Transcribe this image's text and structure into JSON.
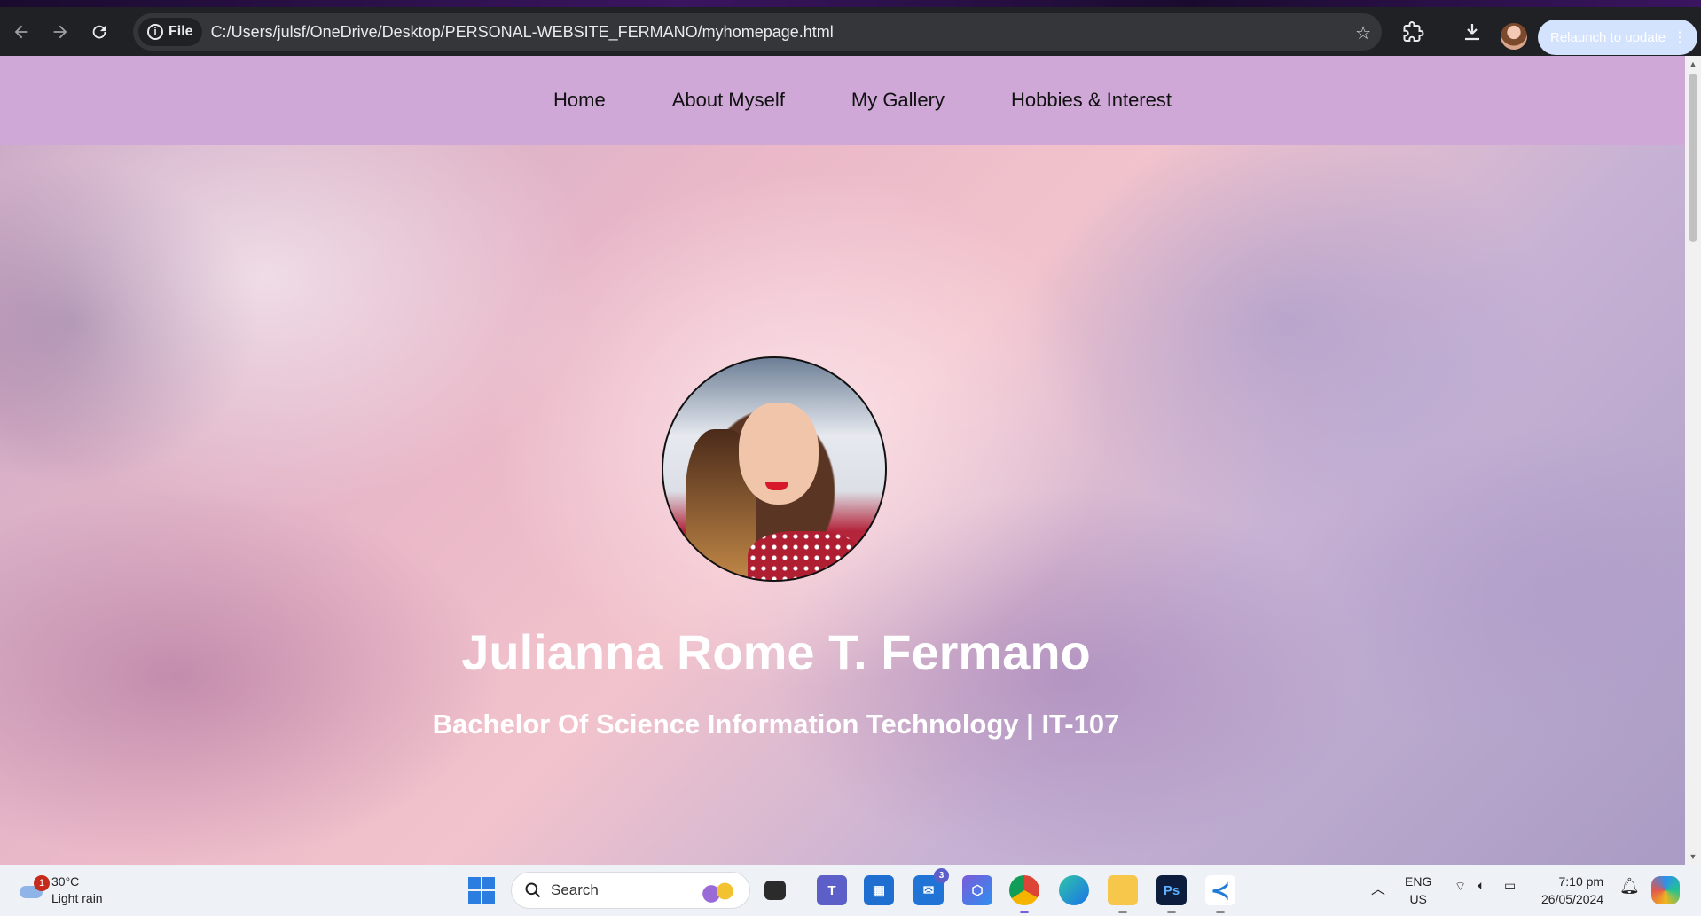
{
  "browser": {
    "file_chip_label": "File",
    "info_glyph": "i",
    "url": "C:/Users/julsf/OneDrive/Desktop/PERSONAL-WEBSITE_FERMANO/myhomepage.html",
    "relaunch_label": "Relaunch to update",
    "menu_glyph": "⋮"
  },
  "site": {
    "nav": [
      "Home",
      "About Myself",
      "My Gallery",
      "Hobbies & Interest"
    ],
    "name": "Julianna Rome T. Fermano",
    "subtitle": "Bachelor Of Science Information Technology | IT-107",
    "nav_bg": "#cfa8d8"
  },
  "taskbar": {
    "weather_temp": "30°C",
    "weather_desc": "Light rain",
    "weather_badge": "1",
    "search_placeholder": "Search",
    "mail_badge": "3",
    "lang_line1": "ENG",
    "lang_line2": "US",
    "time": "7:10 pm",
    "date": "26/05/2024",
    "ps_label": "Ps"
  }
}
